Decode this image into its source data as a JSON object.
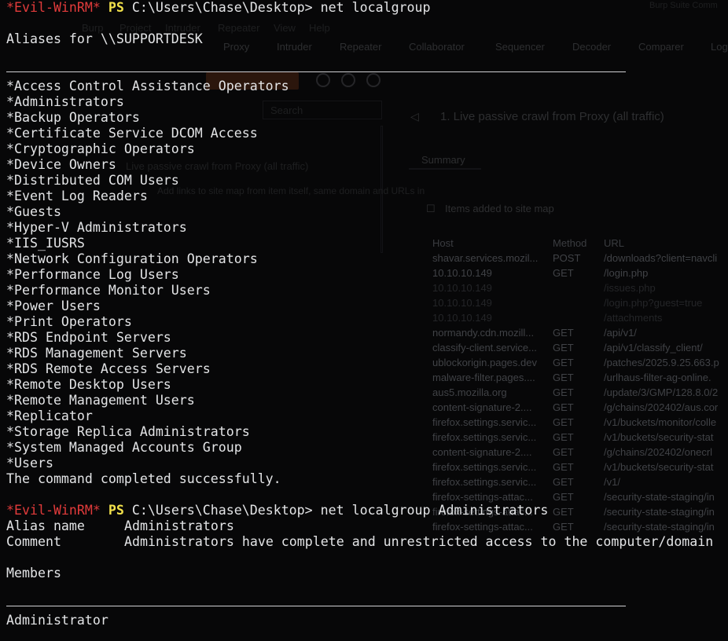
{
  "background": {
    "top_right_title": "Burp Suite Comm",
    "menu": [
      "Burp",
      "Project",
      "Intruder",
      "Repeater",
      "View",
      "Help"
    ],
    "tabs": [
      "Proxy",
      "Intruder",
      "Repeater",
      "Collaborator",
      "Sequencer",
      "Decoder",
      "Comparer",
      "Log"
    ],
    "search_placeholder": "Search",
    "task_title": "1. Live passive crawl from Proxy (all traffic)",
    "task_item": "Live passive crawl from Proxy (all traffic)",
    "task_sub": "Add links to site map from item itself, same domain and URLs in",
    "summary_tab": "Summary",
    "items_label": "Items added to site map",
    "col_host": "Host",
    "col_method": "Method",
    "col_url": "URL",
    "rows": [
      {
        "host": "shavar.services.mozil...",
        "method": "POST",
        "url": "/downloads?client=navcli"
      },
      {
        "host": "10.10.10.149",
        "method": "GET",
        "url": "/login.php"
      },
      {
        "host": "10.10.10.149",
        "method": "",
        "url": "/issues.php"
      },
      {
        "host": "10.10.10.149",
        "method": "",
        "url": "/login.php?guest=true"
      },
      {
        "host": "10.10.10.149",
        "method": "",
        "url": "/attachments"
      },
      {
        "host": "normandy.cdn.mozill...",
        "method": "GET",
        "url": "/api/v1/"
      },
      {
        "host": "classify-client.service...",
        "method": "GET",
        "url": "/api/v1/classify_client/"
      },
      {
        "host": "ublockorigin.pages.dev",
        "method": "GET",
        "url": "/patches/2025.9.25.663.p"
      },
      {
        "host": "malware-filter.pages....",
        "method": "GET",
        "url": "/urlhaus-filter-ag-online."
      },
      {
        "host": "aus5.mozilla.org",
        "method": "GET",
        "url": "/update/3/GMP/128.8.0/2"
      },
      {
        "host": "content-signature-2....",
        "method": "GET",
        "url": "/g/chains/202402/aus.cor"
      },
      {
        "host": "firefox.settings.servic...",
        "method": "GET",
        "url": "/v1/buckets/monitor/colle"
      },
      {
        "host": "firefox.settings.servic...",
        "method": "GET",
        "url": "/v1/buckets/security-stat"
      },
      {
        "host": "content-signature-2....",
        "method": "GET",
        "url": "/g/chains/202402/onecrl"
      },
      {
        "host": "firefox.settings.servic...",
        "method": "GET",
        "url": "/v1/buckets/security-stat"
      },
      {
        "host": "firefox.settings.servic...",
        "method": "GET",
        "url": "/v1/"
      },
      {
        "host": "firefox-settings-attac...",
        "method": "GET",
        "url": "/security-state-staging/in"
      },
      {
        "host": "firefox-settings-attac...",
        "method": "GET",
        "url": "/security-state-staging/in"
      },
      {
        "host": "firefox-settings-attac...",
        "method": "GET",
        "url": "/security-state-staging/in"
      }
    ]
  },
  "terminal": {
    "prompt_name": "*Evil-WinRM*",
    "prompt_ps": "PS",
    "path": "C:\\Users\\Chase\\Desktop>",
    "command1": "net localgroup",
    "aliases_header": "Aliases for \\\\SUPPORTDESK",
    "groups": [
      "*Access Control Assistance Operators",
      "*Administrators",
      "*Backup Operators",
      "*Certificate Service DCOM Access",
      "*Cryptographic Operators",
      "*Device Owners",
      "*Distributed COM Users",
      "*Event Log Readers",
      "*Guests",
      "*Hyper-V Administrators",
      "*IIS_IUSRS",
      "*Network Configuration Operators",
      "*Performance Log Users",
      "*Performance Monitor Users",
      "*Power Users",
      "*Print Operators",
      "*RDS Endpoint Servers",
      "*RDS Management Servers",
      "*RDS Remote Access Servers",
      "*Remote Desktop Users",
      "*Remote Management Users",
      "*Replicator",
      "*Storage Replica Administrators",
      "*System Managed Accounts Group",
      "*Users"
    ],
    "completed": "The command completed successfully.",
    "command2": "net localgroup Administrators",
    "alias_name_key": "Alias name",
    "alias_name_value": "Administrators",
    "comment_key": "Comment",
    "comment_value": "Administrators have complete and unrestricted access to the computer/domain",
    "members_label": "Members",
    "member": "Administrator"
  }
}
